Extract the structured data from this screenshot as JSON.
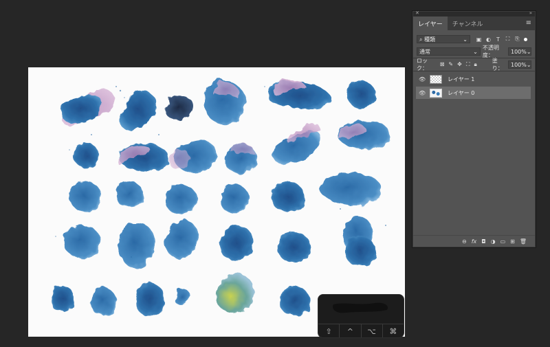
{
  "panel": {
    "tabs": [
      {
        "label": "レイヤー",
        "active": true
      },
      {
        "label": "チャンネル",
        "active": false
      }
    ],
    "filter": {
      "kind_label": "種類"
    },
    "blend_mode": "通常",
    "opacity_label": "不透明度：",
    "opacity_value": "100%",
    "lock_label": "ロック：",
    "fill_label": "塗り：",
    "fill_value": "100%",
    "layers": [
      {
        "name": "レイヤー 1",
        "selected": false,
        "thumb": "transparent"
      },
      {
        "name": "レイヤー 0",
        "selected": true,
        "thumb": "image"
      }
    ]
  },
  "shortcut_overlay": {
    "keys": [
      "⇧",
      "^",
      "⌥",
      "⌘"
    ]
  },
  "colors": {
    "app_bg": "#262626",
    "panel_bg": "#535353",
    "selected_layer": "#6d6d6d",
    "ink_blue": "#2f6fa8",
    "ink_purple": "#b58ab8"
  }
}
